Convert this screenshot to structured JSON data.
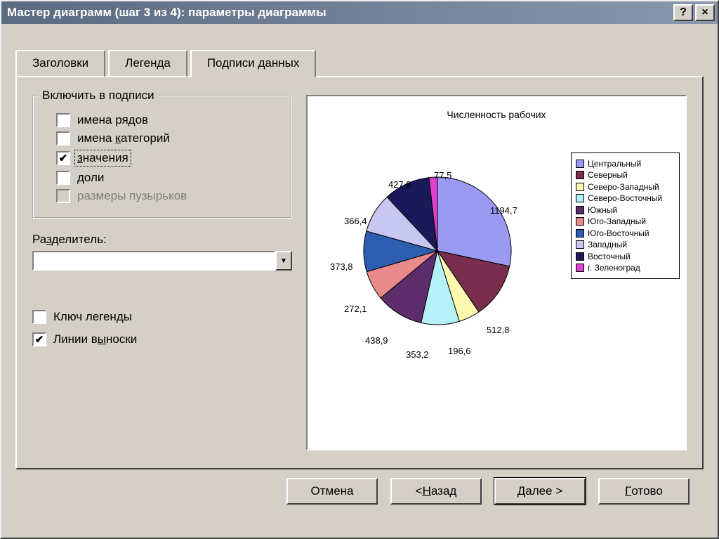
{
  "window": {
    "title": "Мастер диаграмм (шаг 3 из 4): параметры диаграммы"
  },
  "tabs": {
    "t0": "Заголовки",
    "t1": "Легенда",
    "t2": "Подписи данных"
  },
  "group": {
    "caption": "Включить в подписи",
    "chk0": "имена рядов",
    "chk1_pre": "имена ",
    "chk1_u": "к",
    "chk1_post": "атегорий",
    "chk2_u": "з",
    "chk2_post": "начения",
    "chk3_u": "д",
    "chk3_post": "оли",
    "chk4": "размеры пузырьков"
  },
  "separator": {
    "label_pre": "Ра",
    "label_u": "з",
    "label_post": "делитель:"
  },
  "extra": {
    "chk_key": "Ключ легенды",
    "chk_leader_pre": "Линии в",
    "chk_leader_u": "ы",
    "chk_leader_post": "носки"
  },
  "chart_data": {
    "type": "pie",
    "title": "Численность рабочих",
    "series": [
      {
        "name": "Центральный",
        "value": 1194.7,
        "label": "1194,7",
        "color": "#9a9af2"
      },
      {
        "name": "Северный",
        "value": 512.8,
        "label": "512,8",
        "color": "#7a2d4d"
      },
      {
        "name": "Северо-Западный",
        "value": 196.6,
        "label": "196,6",
        "color": "#fdfab0"
      },
      {
        "name": "Северо-Восточный",
        "value": 353.2,
        "label": "353,2",
        "color": "#b4f0f5"
      },
      {
        "name": "Южный",
        "value": 438.9,
        "label": "438,9",
        "color": "#5d2d6b"
      },
      {
        "name": "Юго-Западный",
        "value": 272.1,
        "label": "272,1",
        "color": "#e88a8a"
      },
      {
        "name": "Юго-Восточный",
        "value": 373.8,
        "label": "373,8",
        "color": "#2d5db0"
      },
      {
        "name": "Западный",
        "value": 366.4,
        "label": "366,4",
        "color": "#c7c7f2"
      },
      {
        "name": "Восточный",
        "value": 427.8,
        "label": "427,8",
        "color": "#1a1a5a"
      },
      {
        "name": "г. Зеленоград",
        "value": 77.5,
        "label": "77,5",
        "color": "#e040d0"
      }
    ]
  },
  "buttons": {
    "cancel": "Отмена",
    "back_pre": "< ",
    "back_u": "Н",
    "back_post": "азад",
    "next_pre": "",
    "next_u": "Д",
    "next_post": "алее >",
    "finish_u": "Г",
    "finish_post": "отово"
  }
}
